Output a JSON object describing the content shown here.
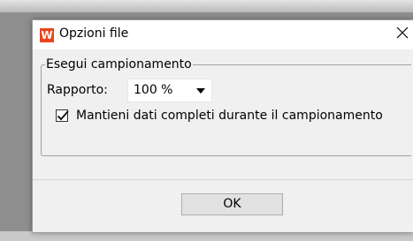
{
  "dialog": {
    "title": "Opzioni file",
    "app_icon_letter": "W",
    "close_glyph": "✕",
    "group": {
      "legend": "Esegui campionamento",
      "ratio_label": "Rapporto:",
      "ratio_value": "100 %",
      "ratio_dropdown_icon": "chevron-down-icon",
      "checkbox_label": "Mantieni dati completi durante il campionamento",
      "checkbox_checked": true
    },
    "ok_label": "OK"
  },
  "colors": {
    "app_icon_bg": "#e8451e",
    "dialog_bg": "#f0f0f0",
    "titlebar_bg": "#ffffff",
    "button_bg": "#e1e1e1"
  }
}
